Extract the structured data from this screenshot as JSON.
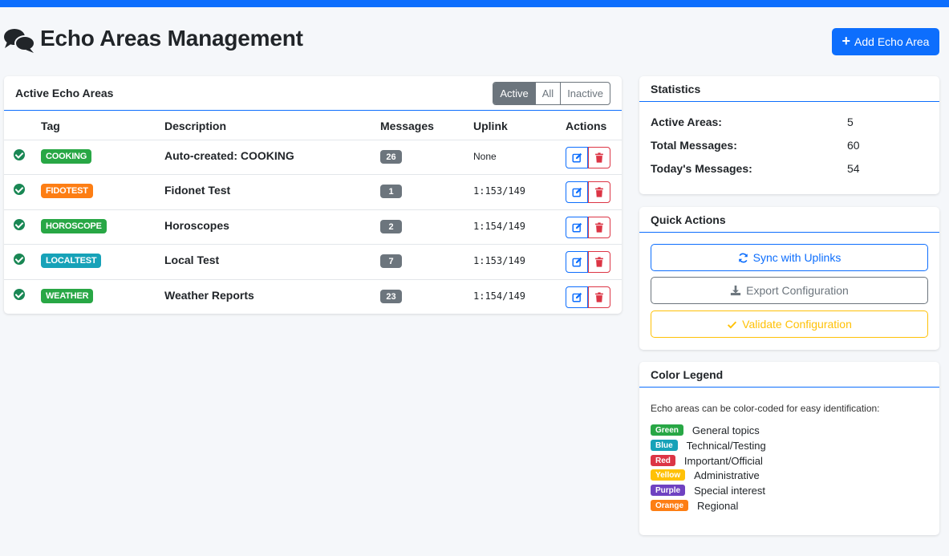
{
  "colors": {
    "primary": "#0d6efd",
    "green": "#28a745",
    "orange": "#fd7e14",
    "teal": "#17a2b8",
    "red": "#dc3545",
    "yellow": "#ffc107",
    "purple": "#6f42c1",
    "gray": "#6c757d"
  },
  "header": {
    "title": "Echo Areas Management",
    "icon": "comments-icon",
    "add_button_label": "Add Echo Area"
  },
  "main": {
    "title": "Active Echo Areas",
    "filters": [
      "Active",
      "All",
      "Inactive"
    ],
    "active_filter": "Active",
    "columns": [
      "Tag",
      "Description",
      "Messages",
      "Uplink",
      "Actions"
    ],
    "rows": [
      {
        "tag": "COOKING",
        "color": "#28a745",
        "description": "Auto-created: COOKING",
        "messages": "26",
        "uplink": "None"
      },
      {
        "tag": "FIDOTEST",
        "color": "#fd7e14",
        "description": "Fidonet Test",
        "messages": "1",
        "uplink": "1:153/149"
      },
      {
        "tag": "HOROSCOPE",
        "color": "#28a745",
        "description": "Horoscopes",
        "messages": "2",
        "uplink": "1:154/149"
      },
      {
        "tag": "LOCALTEST",
        "color": "#17a2b8",
        "description": "Local Test",
        "messages": "7",
        "uplink": "1:153/149"
      },
      {
        "tag": "WEATHER",
        "color": "#28a745",
        "description": "Weather Reports",
        "messages": "23",
        "uplink": "1:154/149"
      }
    ]
  },
  "statistics": {
    "title": "Statistics",
    "items": [
      {
        "label": "Active Areas:",
        "value": "5"
      },
      {
        "label": "Total Messages:",
        "value": "60"
      },
      {
        "label": "Today's Messages:",
        "value": "54"
      }
    ]
  },
  "quick_actions": {
    "title": "Quick Actions",
    "sync_label": "Sync with Uplinks",
    "export_label": "Export Configuration",
    "validate_label": "Validate Configuration"
  },
  "legend": {
    "title": "Color Legend",
    "intro": "Echo areas can be color-coded for easy identification:",
    "items": [
      {
        "name": "Green",
        "color": "#28a745",
        "meaning": "General topics"
      },
      {
        "name": "Blue",
        "color": "#17a2b8",
        "meaning": "Technical/Testing"
      },
      {
        "name": "Red",
        "color": "#dc3545",
        "meaning": "Important/Official"
      },
      {
        "name": "Yellow",
        "color": "#ffc107",
        "meaning": "Administrative"
      },
      {
        "name": "Purple",
        "color": "#6f42c1",
        "meaning": "Special interest"
      },
      {
        "name": "Orange",
        "color": "#fd7e14",
        "meaning": "Regional"
      }
    ]
  }
}
